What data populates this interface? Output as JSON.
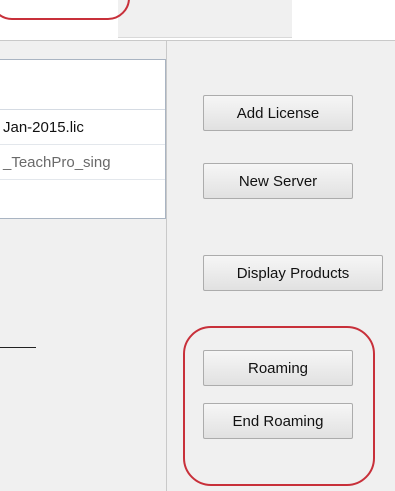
{
  "license_list": {
    "rows": [
      "Jan-2015.lic",
      "_TeachPro_sing"
    ]
  },
  "buttons": {
    "add_license": "Add License",
    "new_server": "New Server",
    "display_products": "Display Products",
    "roaming": "Roaming",
    "end_roaming": "End Roaming"
  },
  "colors": {
    "highlight": "#c8303a",
    "panel_bg": "#f0f0f0"
  }
}
